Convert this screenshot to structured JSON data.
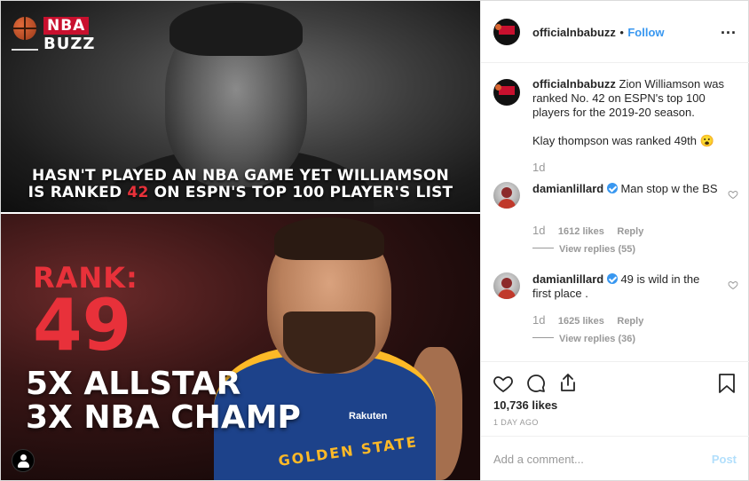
{
  "media": {
    "logo": {
      "nba": "NBA",
      "buzz": "BUZZ"
    },
    "top_panel": {
      "headline_line1": "HASN'T PLAYED AN NBA GAME YET WILLIAMSON",
      "headline_line2_pre": "IS RANKED ",
      "headline_line2_highlight": "42",
      "headline_line2_post": " ON ESPN'S TOP 100 PLAYER'S LIST",
      "highlight_color": "#e8313a"
    },
    "bottom_panel": {
      "rank_label": "RANK:",
      "rank_value": "49",
      "accolade_1": "5X ALLSTAR",
      "accolade_2": "3X NBA CHAMP",
      "jersey_text": "GOLDEN STATE",
      "jersey_brand": "Rakuten"
    }
  },
  "header": {
    "username": "officialnbabuzz",
    "separator": "•",
    "follow_label": "Follow",
    "more_label": "..."
  },
  "caption": {
    "username": "officialnbabuzz",
    "text_line": "Zion Williamson was ranked No. 42 on ESPN's top 100 players for the 2019-20 season.",
    "text_line2": "Klay thompson was ranked 49th 😮",
    "age": "1d"
  },
  "comments": [
    {
      "username": "damianlillard",
      "verified": true,
      "text": "Man stop w the BS",
      "age": "1d",
      "likes": "1612 likes",
      "reply_label": "Reply",
      "view_replies": "View replies (55)"
    },
    {
      "username": "damianlillard",
      "verified": true,
      "text": "49 is wild in the first place .",
      "age": "1d",
      "likes": "1625 likes",
      "reply_label": "Reply",
      "view_replies": "View replies (36)"
    }
  ],
  "actions": {
    "icons": [
      "heart-icon",
      "comment-icon",
      "share-icon",
      "bookmark-icon"
    ],
    "likes": "10,736 likes",
    "timestamp": "1 DAY AGO"
  },
  "add_comment": {
    "placeholder": "Add a comment...",
    "post_label": "Post"
  },
  "colors": {
    "link_blue": "#3897f0",
    "post_disabled": "#b2dffc",
    "muted": "#999999",
    "brand_red": "#c8102e"
  }
}
